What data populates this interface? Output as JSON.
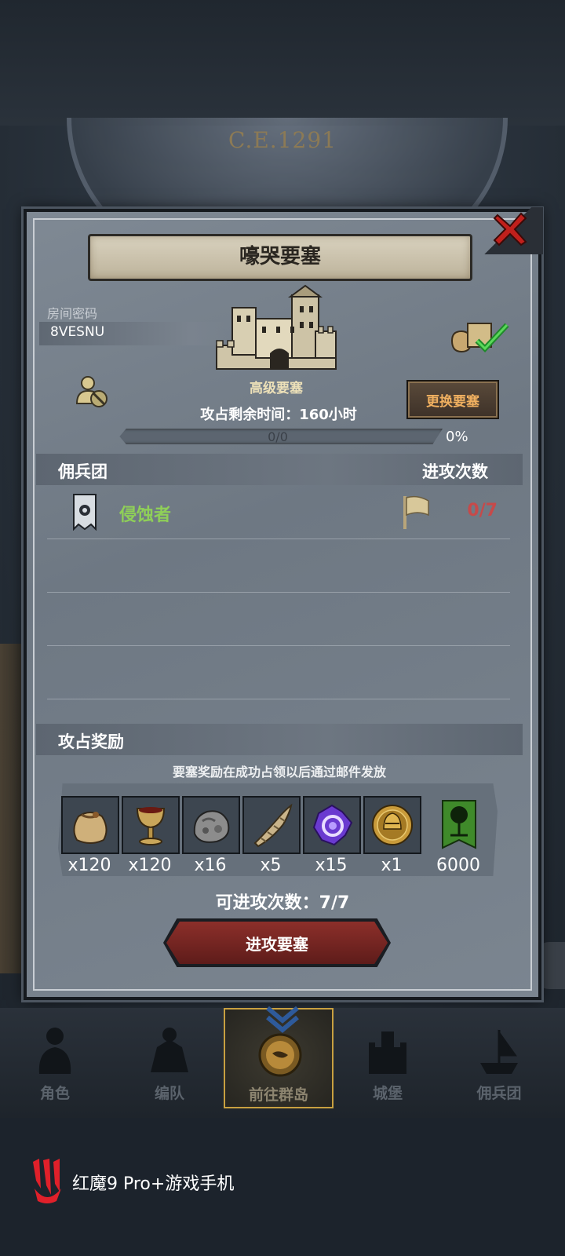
{
  "background": {
    "era_text": "C.E.1291"
  },
  "dialog": {
    "title": "嚎哭要塞",
    "room_code_label": "房间密码",
    "room_code": "8VESNU",
    "fortress_name": "高级要塞",
    "swap_button_label": "更换要塞",
    "time_remaining": "攻占剩余时间：160小时",
    "progress": {
      "text": "0/0",
      "percent_text": "0%",
      "value": 0
    },
    "mercenary_header": "佣兵团",
    "attack_count_header": "进攻次数",
    "mercenaries": [
      {
        "name": "侵蚀者",
        "attacks": "0/7"
      }
    ],
    "rewards_header": "攻占奖励",
    "rewards_note": "要塞奖励在成功占领以后通过邮件发放",
    "rewards": [
      {
        "icon": "sack-icon",
        "qty": "x120"
      },
      {
        "icon": "goblet-icon",
        "qty": "x120"
      },
      {
        "icon": "ore-icon",
        "qty": "x16"
      },
      {
        "icon": "horn-icon",
        "qty": "x5"
      },
      {
        "icon": "purple-gem-icon",
        "qty": "x15"
      },
      {
        "icon": "helmet-coin-icon",
        "qty": "x1"
      },
      {
        "icon": "tree-banner-icon",
        "qty": "6000"
      }
    ],
    "attempts_text": "可进攻次数：7/7",
    "attack_button_label": "进攻要塞"
  },
  "nav": {
    "items": [
      {
        "label": "角色"
      },
      {
        "label": "编队"
      },
      {
        "label": "前往群岛"
      },
      {
        "label": "城堡"
      },
      {
        "label": "佣兵团"
      }
    ],
    "active_index": 2
  },
  "watermark": {
    "text": "红魔9 Pro+游戏手机"
  },
  "colors": {
    "accent_green": "#8fcf58",
    "count_red": "#c64a4a",
    "swap_orange": "#f0b060",
    "button_red": "#8c2f2a"
  }
}
